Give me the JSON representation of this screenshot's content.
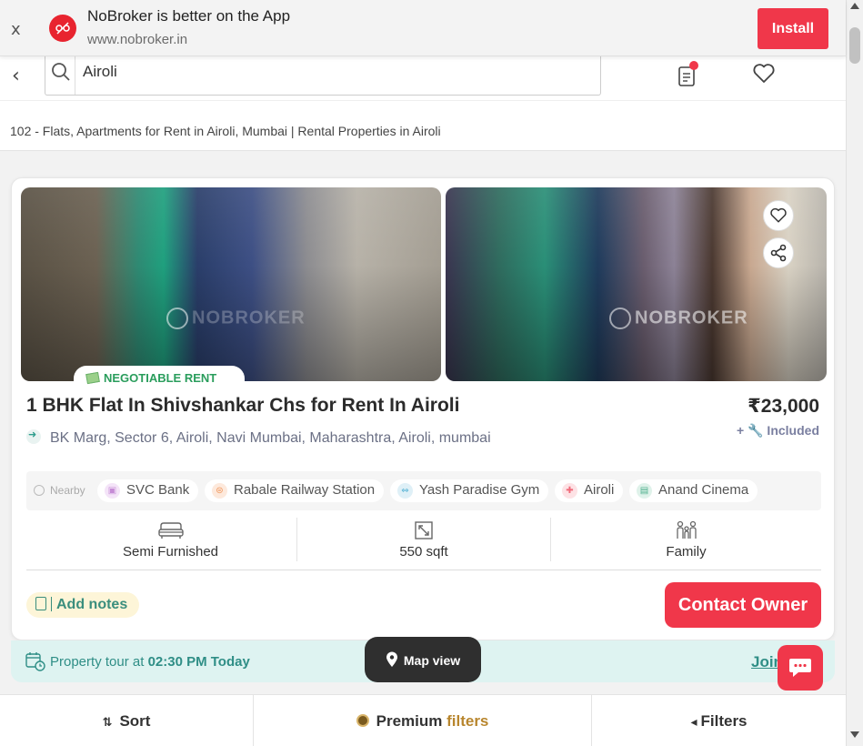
{
  "app_banner": {
    "close_label": "x",
    "title": "NoBroker is better on the App",
    "url": "www.nobroker.in",
    "install_label": "Install",
    "accent": "#f0374a"
  },
  "search": {
    "value": "Airoli",
    "back_icon": "back-arrow-icon"
  },
  "breadcrumb": "102 - Flats, Apartments for Rent in Airoli, Mumbai | Rental Properties in Airoli",
  "listing": {
    "watermark": "NOBROKER",
    "badge": "NEGOTIABLE RENT",
    "title": "1 BHK Flat In Shivshankar Chs for Rent In Airoli",
    "price": "₹23,000",
    "included": "+ 🔧 Included",
    "address": "BK Marg, Sector 6, Airoli, Navi Mumbai, Maharashtra, Airoli, mumbai",
    "nearby_label": "Nearby",
    "nearby": [
      {
        "label": "SVC Bank",
        "icon": "bank-icon",
        "color": "#c68bd6"
      },
      {
        "label": "Rabale Railway Station",
        "icon": "train-icon",
        "color": "#f0955a"
      },
      {
        "label": "Yash Paradise Gym",
        "icon": "gym-icon",
        "color": "#5bb5d6"
      },
      {
        "label": "Airoli",
        "icon": "hospital-icon",
        "color": "#f06a7a"
      },
      {
        "label": "Anand Cinema",
        "icon": "cinema-icon",
        "color": "#4fb08e"
      }
    ],
    "amenities": [
      {
        "label": "Semi Furnished",
        "icon": "sofa-icon"
      },
      {
        "label": "550 sqft",
        "icon": "area-icon"
      },
      {
        "label": "Family",
        "icon": "family-icon"
      }
    ],
    "add_notes_label": "Add notes",
    "contact_label": "Contact Owner"
  },
  "tour": {
    "prefix": "Property tour at ",
    "time": "02:30 PM Today",
    "join_label": "Join"
  },
  "map_view_label": "Map view",
  "bottom_bar": {
    "sort_label": "Sort",
    "premium_label_1": "Premium ",
    "premium_label_2": "filters",
    "filters_label": "Filters"
  }
}
